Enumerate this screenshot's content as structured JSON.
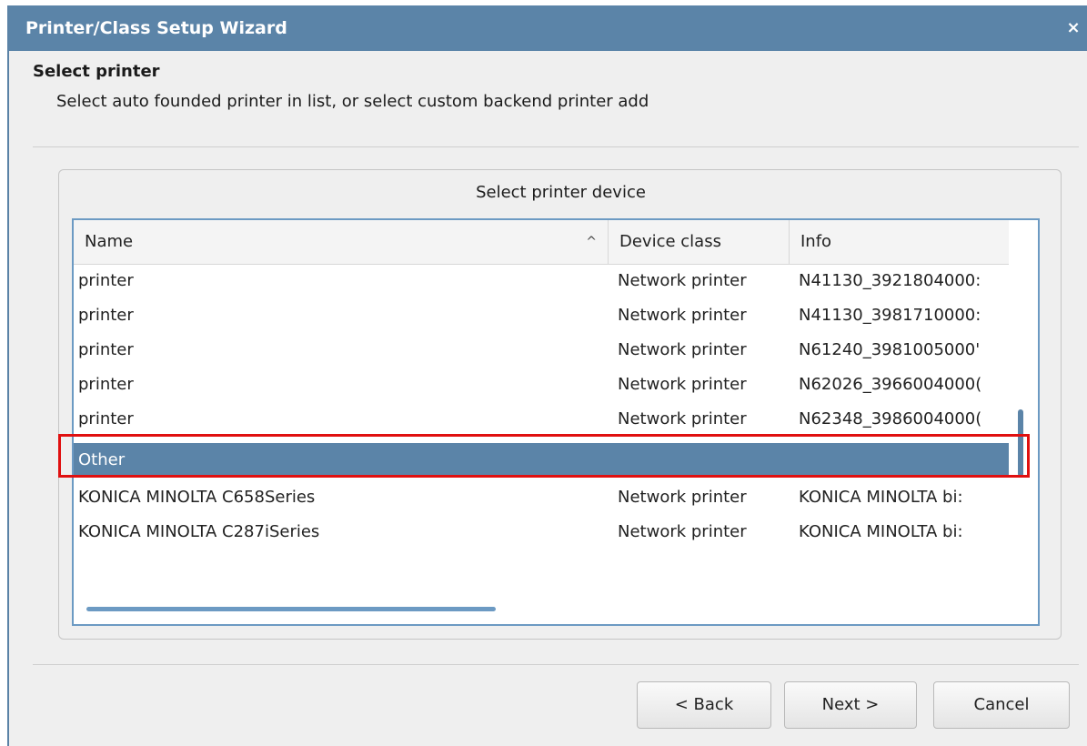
{
  "window": {
    "title": "Printer/Class Setup Wizard",
    "close_glyph": "×"
  },
  "header": {
    "title": "Select printer",
    "subtitle": "Select auto founded printer in list, or select custom backend printer add"
  },
  "group": {
    "title": "Select printer device"
  },
  "table": {
    "columns": [
      "Name",
      "Device class",
      "Info"
    ],
    "sort_indicator": "^",
    "rows": [
      {
        "name": "printer",
        "device_class": "Network printer",
        "info": "N41130_3921804000:"
      },
      {
        "name": "printer",
        "device_class": "Network printer",
        "info": "N41130_3981710000:"
      },
      {
        "name": "printer",
        "device_class": "Network printer",
        "info": "N61240_3981005000'"
      },
      {
        "name": "printer",
        "device_class": "Network printer",
        "info": "N62026_3966004000("
      },
      {
        "name": "printer",
        "device_class": "Network printer",
        "info": "N62348_3986004000("
      },
      {
        "name": "Other",
        "device_class": "",
        "info": "",
        "selected": true
      },
      {
        "name": "KONICA MINOLTA C658Series",
        "device_class": "Network printer",
        "info": "KONICA MINOLTA bi:"
      },
      {
        "name": "KONICA MINOLTA C287iSeries",
        "device_class": "Network printer",
        "info": "KONICA MINOLTA bi:"
      }
    ]
  },
  "buttons": {
    "back": "< Back",
    "next": "Next >",
    "cancel": "Cancel"
  },
  "colors": {
    "titlebar": "#5b84a8",
    "selection": "#5b84a8",
    "annotation": "#e01010"
  }
}
